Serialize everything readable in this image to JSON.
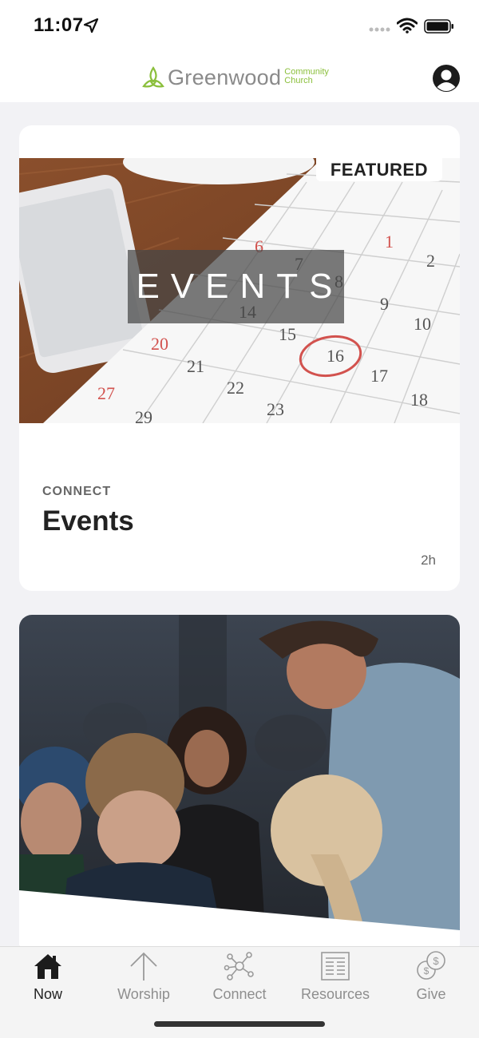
{
  "status_bar": {
    "time": "11:07"
  },
  "header": {
    "logo_name": "Greenwood",
    "logo_sub_line1": "Community",
    "logo_sub_line2": "Church",
    "brand_color": "#8bbf3c"
  },
  "feed": {
    "cards": [
      {
        "badge": "FEATURED",
        "banner_text": "EVENTS",
        "category": "CONNECT",
        "title": "Events",
        "time_ago": "2h"
      },
      {
        "image": "worship-congregation-photo"
      }
    ]
  },
  "tab_bar": {
    "items": [
      {
        "label": "Now",
        "icon": "home-icon",
        "active": true
      },
      {
        "label": "Worship",
        "icon": "arrow-up-icon",
        "active": false
      },
      {
        "label": "Connect",
        "icon": "network-icon",
        "active": false
      },
      {
        "label": "Resources",
        "icon": "document-icon",
        "active": false
      },
      {
        "label": "Give",
        "icon": "coins-icon",
        "active": false
      }
    ]
  }
}
